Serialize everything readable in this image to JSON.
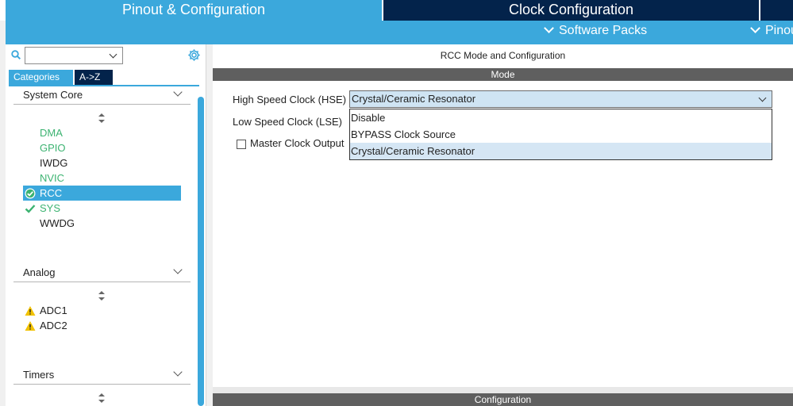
{
  "tabs": {
    "pinout_label": "Pinout & Configuration",
    "clock_label": "Clock Configuration"
  },
  "subbar": {
    "software_packs": "Software Packs",
    "pinout": "Pinout"
  },
  "left": {
    "category_tabs": [
      "Categories",
      "A->Z"
    ],
    "sections": [
      {
        "name": "System Core",
        "items": [
          {
            "label": "DMA",
            "state": "green",
            "icon": ""
          },
          {
            "label": "GPIO",
            "state": "green",
            "icon": ""
          },
          {
            "label": "IWDG",
            "state": "dark",
            "icon": ""
          },
          {
            "label": "NVIC",
            "state": "green",
            "icon": ""
          },
          {
            "label": "RCC",
            "state": "selected",
            "icon": "check-circle-icon"
          },
          {
            "label": "SYS",
            "state": "green",
            "icon": "check-icon"
          },
          {
            "label": "WWDG",
            "state": "dark",
            "icon": ""
          }
        ]
      },
      {
        "name": "Analog",
        "items": [
          {
            "label": "ADC1",
            "state": "dark",
            "icon": "warning-icon"
          },
          {
            "label": "ADC2",
            "state": "dark",
            "icon": "warning-icon"
          }
        ]
      },
      {
        "name": "Timers",
        "items": []
      }
    ]
  },
  "right": {
    "title": "RCC Mode and Configuration",
    "mode_header": "Mode",
    "hse_label": "High Speed Clock (HSE)",
    "hse_value": "Crystal/Ceramic Resonator",
    "hse_options": [
      "Disable",
      "BYPASS Clock Source",
      "Crystal/Ceramic Resonator"
    ],
    "hse_selected_index": 2,
    "lse_label": "Low Speed Clock (LSE)",
    "mco_label": "Master Clock Output",
    "config_header": "Configuration"
  },
  "colors": {
    "accent": "#3ba8dc",
    "dark_navy": "#03234b",
    "green": "#3cb371",
    "warning": "#f2c200",
    "header_gray": "#5f5f5f"
  }
}
